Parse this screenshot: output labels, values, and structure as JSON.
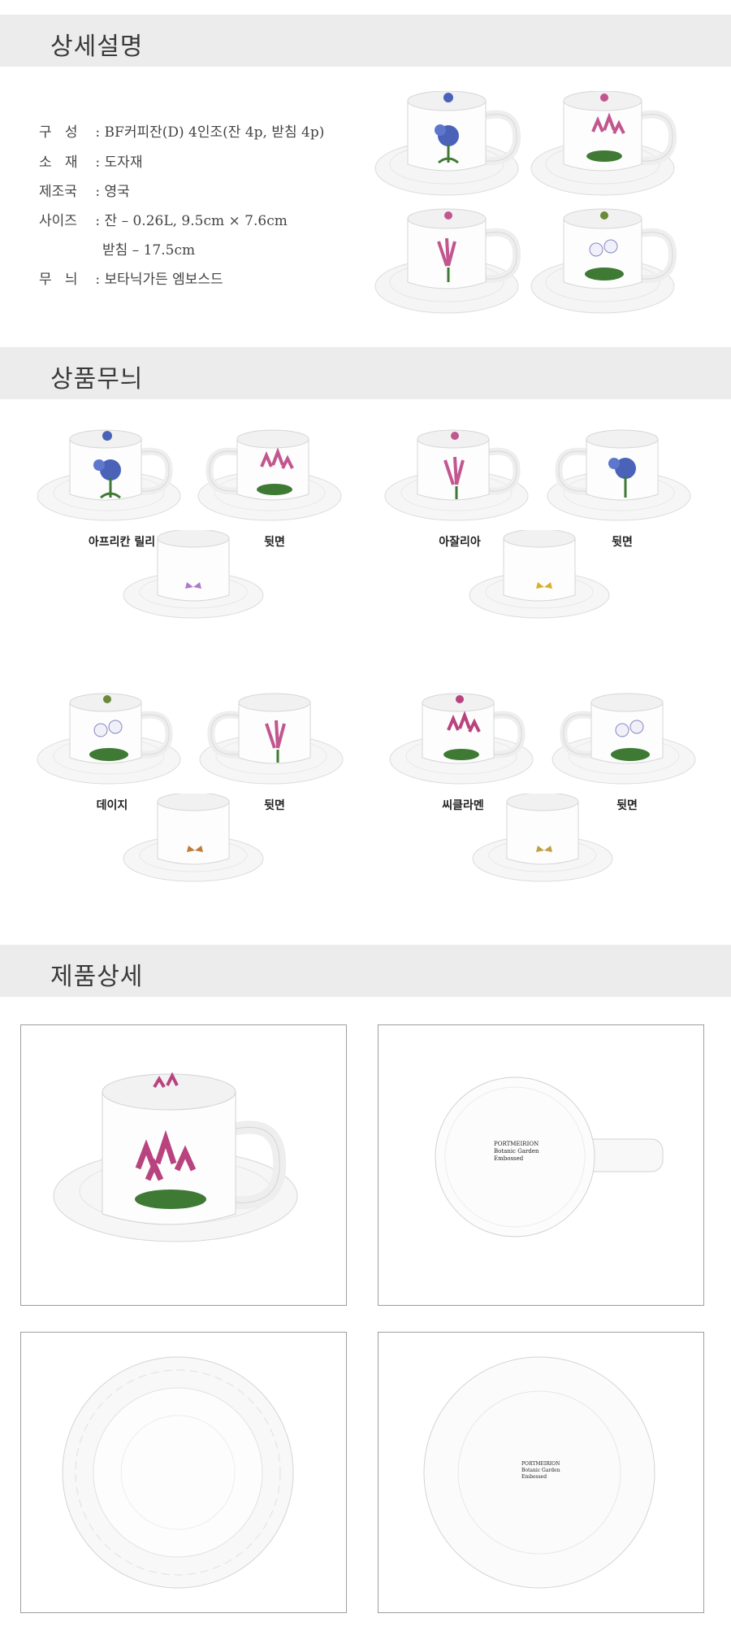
{
  "sections": {
    "description_title": "상세설명",
    "pattern_title": "상품무늬",
    "detail_title": "제품상세"
  },
  "specs": [
    {
      "label": "구   성",
      "value": " : BF커피잔(D) 4인조(잔 4p, 받침 4p)"
    },
    {
      "label": "소   재",
      "value": " : 도자재"
    },
    {
      "label": "제조국",
      "value": " : 영국"
    },
    {
      "label": "사이즈",
      "value": " : 잔 – 0.26L, 9.5cm × 7.6cm"
    },
    {
      "label": "",
      "value": "받침 – 17.5cm"
    },
    {
      "label": "무   늬",
      "value": " : 보타닉가든 엠보스드"
    }
  ],
  "patterns": [
    {
      "front": "아프리칸 릴리",
      "back": "뒷면"
    },
    {
      "front": "아잘리아",
      "back": "뒷면"
    },
    {
      "front": "데이지",
      "back": "뒷면"
    },
    {
      "front": "씨클라멘",
      "back": "뒷면"
    }
  ],
  "backstamp": {
    "brand": "PORTMEIRION",
    "line1": "Botanic Garden",
    "line2": "Embossed"
  },
  "colors": {
    "header_bg": "#ececec",
    "flower_blue": "#4a63b8",
    "flower_pink": "#c2568f",
    "flower_magenta": "#b8437f",
    "leaf_green": "#3f7a35",
    "porcelain": "#fbfbfb"
  }
}
